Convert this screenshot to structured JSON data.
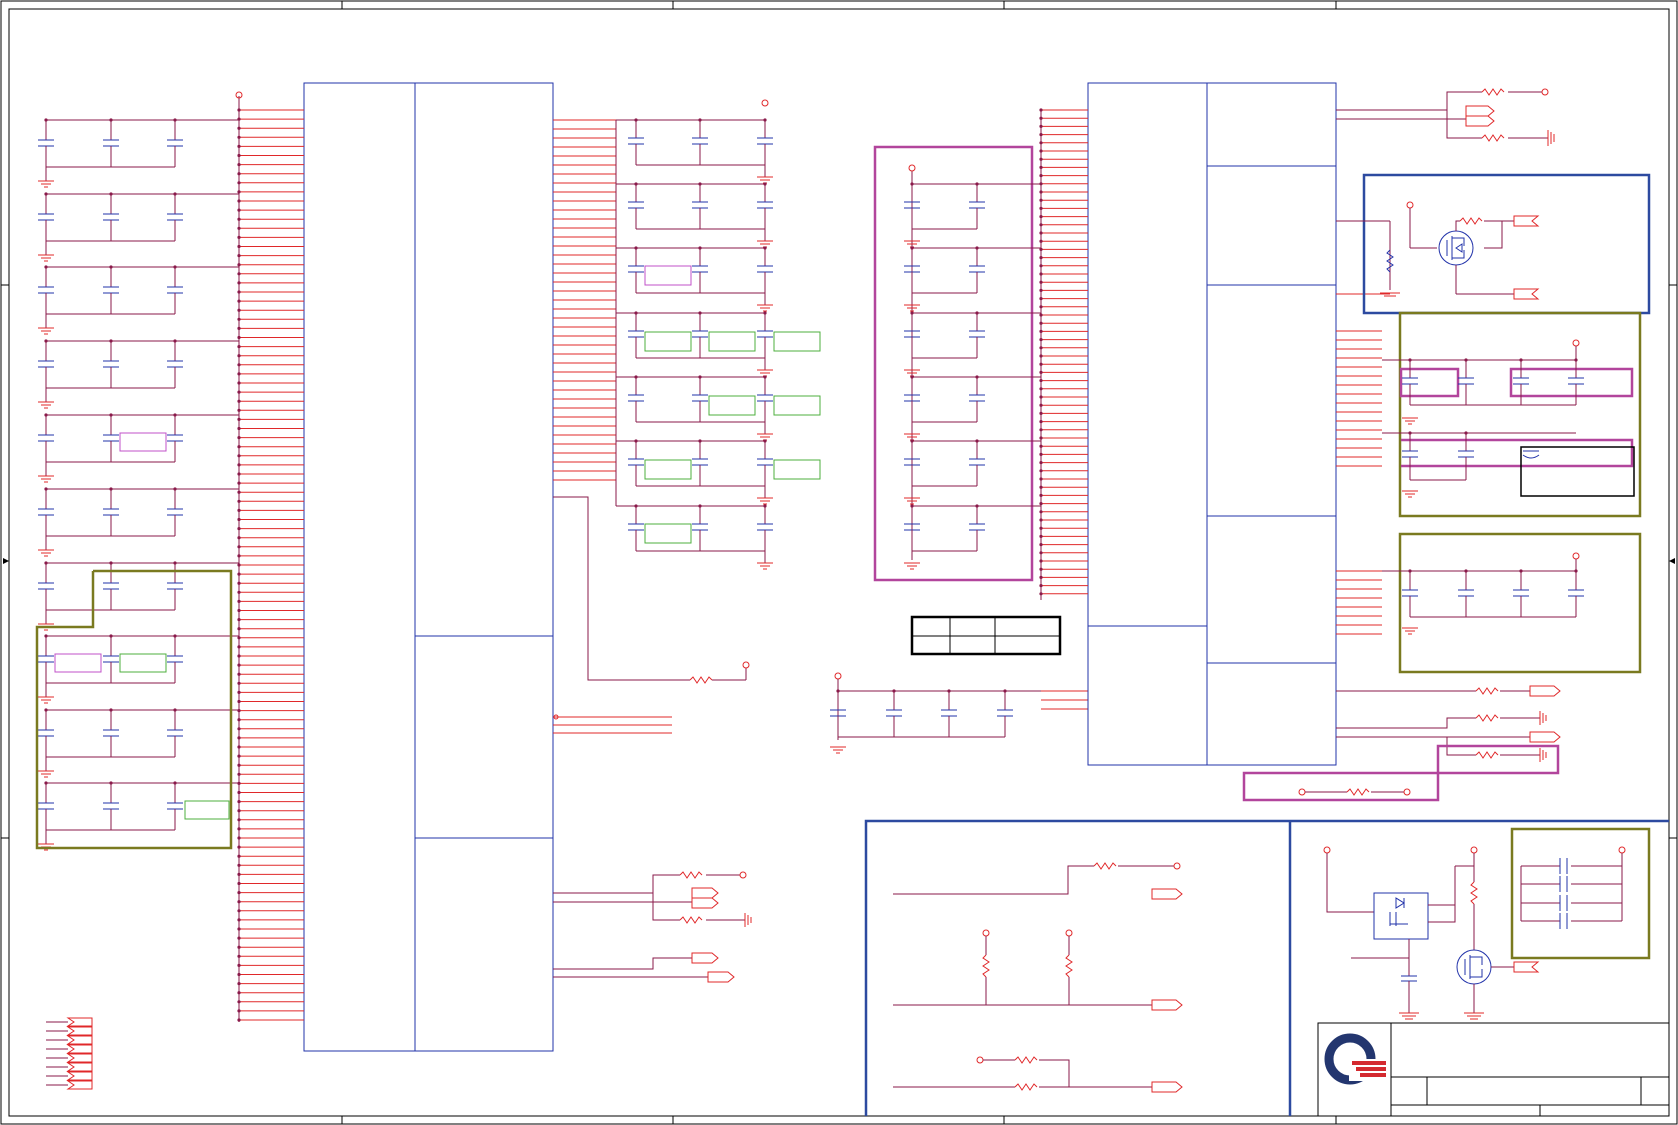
{
  "sheet": {
    "description": "",
    "title_block": {
      "logo_icon": "company-logo-icon",
      "title": "",
      "doc_number": "",
      "revision": ""
    }
  },
  "legend_table": {
    "cells": [
      "",
      "",
      ""
    ]
  },
  "colors": {
    "frame": "#000000",
    "component_red": "#e0282a",
    "wire_purple": "#8a1a4a",
    "component_blue": "#2233aa",
    "group_blue": "#2d4aa0",
    "group_olive": "#7a7a20",
    "group_magenta": "#b2459c",
    "dnp_green": "#4caf3c",
    "note_magenta": "#c050c8"
  }
}
